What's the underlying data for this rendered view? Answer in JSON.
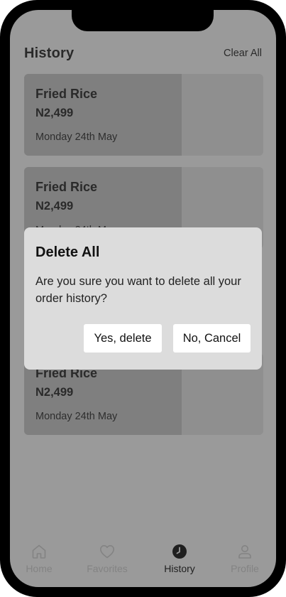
{
  "header": {
    "title": "History",
    "clear_all": "Clear All"
  },
  "orders": [
    {
      "name": "Fried Rice",
      "price": "N2,499",
      "date": "Monday 24th May"
    },
    {
      "name": "Fried Rice",
      "price": "N2,499",
      "date": "Monday 24th May"
    },
    {
      "name": "Fried Rice",
      "price": "N2,499",
      "date": "Monday 24th May"
    }
  ],
  "dialog": {
    "title": "Delete All",
    "message": "Are you sure you want to delete all your order history?",
    "confirm_label": "Yes, delete",
    "cancel_label": "No, Cancel"
  },
  "tabs": [
    {
      "label": "Home",
      "icon": "home-icon",
      "active": false
    },
    {
      "label": "Favorites",
      "icon": "heart-icon",
      "active": false
    },
    {
      "label": "History",
      "icon": "clock-icon",
      "active": true
    },
    {
      "label": "Profile",
      "icon": "user-icon",
      "active": false
    }
  ]
}
